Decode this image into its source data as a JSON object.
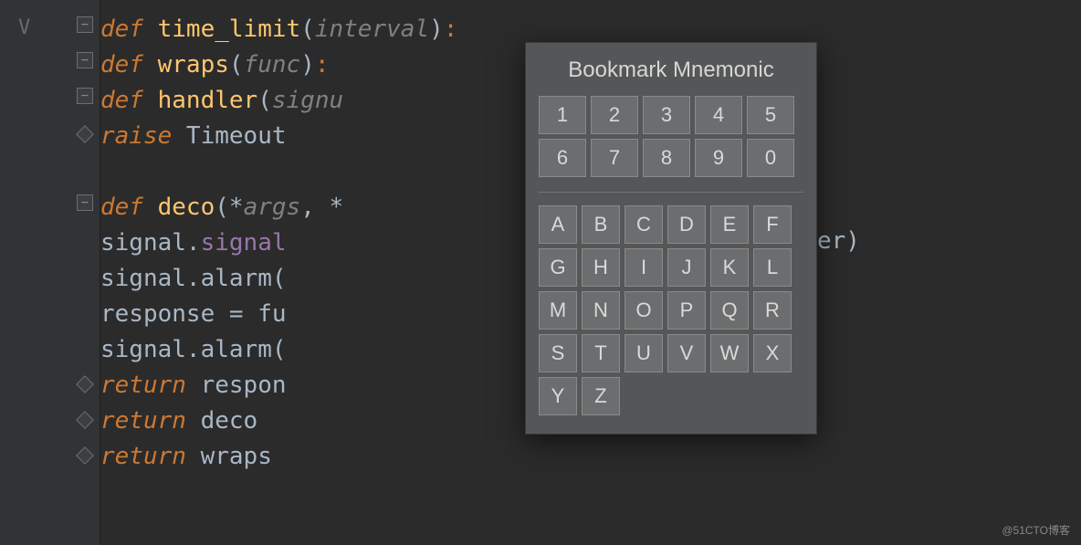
{
  "gutter": {
    "arrow": "V"
  },
  "code": {
    "l1": {
      "kw": "def ",
      "func": "time_limit",
      "p1": "(",
      "param": "interval",
      "p2": ")",
      "colon": ":"
    },
    "l2": {
      "kw": "def ",
      "func": "wraps",
      "p1": "(",
      "param": "func",
      "p2": ")",
      "colon": ":"
    },
    "l3": {
      "kw": "def ",
      "func": "handler",
      "p1": "(",
      "param": "signu"
    },
    "l4": {
      "kw": "raise ",
      "ident": "Timeout"
    },
    "l5": {
      "txt": ""
    },
    "l6": {
      "kw": "def ",
      "func": "deco",
      "p1": "(",
      "star": "*",
      "param": "args",
      "comma": ", ",
      "star2": "*"
    },
    "l7": {
      "obj": "signal.",
      "attr": "signal"
    },
    "l8": {
      "obj": "signal.",
      "attr": "alarm",
      "p1": "("
    },
    "l9": {
      "lhs": "response ",
      "eq": "= ",
      "rhs": "fu"
    },
    "l10": {
      "obj": "signal.",
      "attr": "alarm",
      "p1": "("
    },
    "l11": {
      "kw": "return ",
      "ident": "respon"
    },
    "l12": {
      "kw": "return ",
      "ident": "deco"
    },
    "l13": {
      "kw": "return ",
      "ident": "wraps"
    }
  },
  "frag": {
    "er": "er)"
  },
  "popup": {
    "title": "Bookmark Mnemonic",
    "numbers": [
      "1",
      "2",
      "3",
      "4",
      "5",
      "6",
      "7",
      "8",
      "9",
      "0"
    ],
    "letters": [
      "A",
      "B",
      "C",
      "D",
      "E",
      "F",
      "G",
      "H",
      "I",
      "J",
      "K",
      "L",
      "M",
      "N",
      "O",
      "P",
      "Q",
      "R",
      "S",
      "T",
      "U",
      "V",
      "W",
      "X",
      "Y",
      "Z"
    ]
  },
  "watermark": "@51CTO博客"
}
